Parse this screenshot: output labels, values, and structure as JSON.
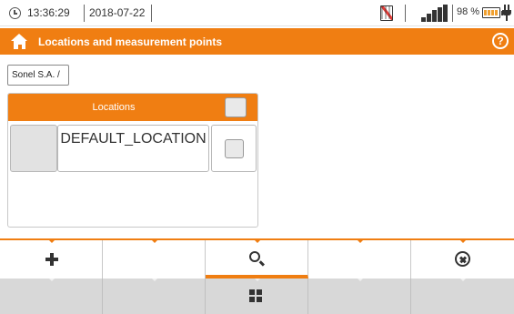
{
  "status_bar": {
    "time": "13:36:29",
    "date": "2018-07-22",
    "battery_percent": "98 %",
    "icons": [
      "clock-icon",
      "memory-card-disabled-icon",
      "signal-strength-icon",
      "battery-icon",
      "plug-icon"
    ],
    "signal_bars": 5,
    "battery_level": 0.98
  },
  "title_bar": {
    "title": "Locations and measurement points",
    "icons": [
      "home-icon",
      "help-icon"
    ],
    "help_glyph": "?",
    "color": "#f07e12"
  },
  "breadcrumb": "Sonel S.A. /",
  "locations_panel": {
    "header": "Locations",
    "rows": [
      {
        "name": "DEFAULT_LOCATION",
        "checked": false
      }
    ]
  },
  "toolbar": {
    "top_row": [
      {
        "icon": "plus-icon",
        "action": "add"
      },
      {
        "icon": "",
        "action": ""
      },
      {
        "icon": "search-icon",
        "action": "search",
        "active": true
      },
      {
        "icon": "",
        "action": ""
      },
      {
        "icon": "cancel-icon",
        "action": "close"
      }
    ],
    "bottom_row": [
      {
        "icon": ""
      },
      {
        "icon": ""
      },
      {
        "icon": "grid-icon",
        "active": true
      },
      {
        "icon": ""
      },
      {
        "icon": ""
      }
    ]
  },
  "colors": {
    "accent": "#f07e12",
    "toolbar_bottom": "#d8d8d8"
  }
}
